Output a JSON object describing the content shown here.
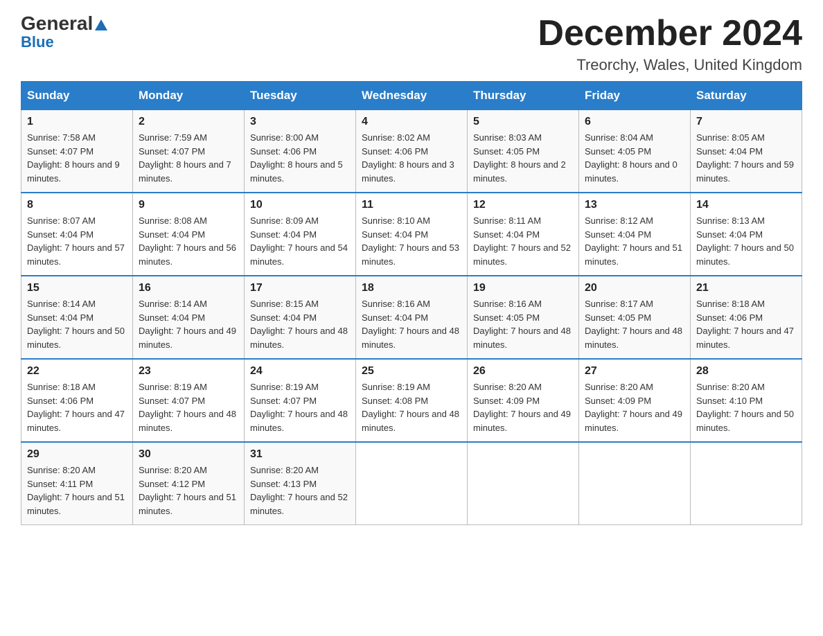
{
  "header": {
    "logo_general": "General",
    "logo_blue": "Blue",
    "month_title": "December 2024",
    "location": "Treorchy, Wales, United Kingdom"
  },
  "weekdays": [
    "Sunday",
    "Monday",
    "Tuesday",
    "Wednesday",
    "Thursday",
    "Friday",
    "Saturday"
  ],
  "weeks": [
    [
      {
        "day": "1",
        "sunrise": "7:58 AM",
        "sunset": "4:07 PM",
        "daylight": "8 hours and 9 minutes."
      },
      {
        "day": "2",
        "sunrise": "7:59 AM",
        "sunset": "4:07 PM",
        "daylight": "8 hours and 7 minutes."
      },
      {
        "day": "3",
        "sunrise": "8:00 AM",
        "sunset": "4:06 PM",
        "daylight": "8 hours and 5 minutes."
      },
      {
        "day": "4",
        "sunrise": "8:02 AM",
        "sunset": "4:06 PM",
        "daylight": "8 hours and 3 minutes."
      },
      {
        "day": "5",
        "sunrise": "8:03 AM",
        "sunset": "4:05 PM",
        "daylight": "8 hours and 2 minutes."
      },
      {
        "day": "6",
        "sunrise": "8:04 AM",
        "sunset": "4:05 PM",
        "daylight": "8 hours and 0 minutes."
      },
      {
        "day": "7",
        "sunrise": "8:05 AM",
        "sunset": "4:04 PM",
        "daylight": "7 hours and 59 minutes."
      }
    ],
    [
      {
        "day": "8",
        "sunrise": "8:07 AM",
        "sunset": "4:04 PM",
        "daylight": "7 hours and 57 minutes."
      },
      {
        "day": "9",
        "sunrise": "8:08 AM",
        "sunset": "4:04 PM",
        "daylight": "7 hours and 56 minutes."
      },
      {
        "day": "10",
        "sunrise": "8:09 AM",
        "sunset": "4:04 PM",
        "daylight": "7 hours and 54 minutes."
      },
      {
        "day": "11",
        "sunrise": "8:10 AM",
        "sunset": "4:04 PM",
        "daylight": "7 hours and 53 minutes."
      },
      {
        "day": "12",
        "sunrise": "8:11 AM",
        "sunset": "4:04 PM",
        "daylight": "7 hours and 52 minutes."
      },
      {
        "day": "13",
        "sunrise": "8:12 AM",
        "sunset": "4:04 PM",
        "daylight": "7 hours and 51 minutes."
      },
      {
        "day": "14",
        "sunrise": "8:13 AM",
        "sunset": "4:04 PM",
        "daylight": "7 hours and 50 minutes."
      }
    ],
    [
      {
        "day": "15",
        "sunrise": "8:14 AM",
        "sunset": "4:04 PM",
        "daylight": "7 hours and 50 minutes."
      },
      {
        "day": "16",
        "sunrise": "8:14 AM",
        "sunset": "4:04 PM",
        "daylight": "7 hours and 49 minutes."
      },
      {
        "day": "17",
        "sunrise": "8:15 AM",
        "sunset": "4:04 PM",
        "daylight": "7 hours and 48 minutes."
      },
      {
        "day": "18",
        "sunrise": "8:16 AM",
        "sunset": "4:04 PM",
        "daylight": "7 hours and 48 minutes."
      },
      {
        "day": "19",
        "sunrise": "8:16 AM",
        "sunset": "4:05 PM",
        "daylight": "7 hours and 48 minutes."
      },
      {
        "day": "20",
        "sunrise": "8:17 AM",
        "sunset": "4:05 PM",
        "daylight": "7 hours and 48 minutes."
      },
      {
        "day": "21",
        "sunrise": "8:18 AM",
        "sunset": "4:06 PM",
        "daylight": "7 hours and 47 minutes."
      }
    ],
    [
      {
        "day": "22",
        "sunrise": "8:18 AM",
        "sunset": "4:06 PM",
        "daylight": "7 hours and 47 minutes."
      },
      {
        "day": "23",
        "sunrise": "8:19 AM",
        "sunset": "4:07 PM",
        "daylight": "7 hours and 48 minutes."
      },
      {
        "day": "24",
        "sunrise": "8:19 AM",
        "sunset": "4:07 PM",
        "daylight": "7 hours and 48 minutes."
      },
      {
        "day": "25",
        "sunrise": "8:19 AM",
        "sunset": "4:08 PM",
        "daylight": "7 hours and 48 minutes."
      },
      {
        "day": "26",
        "sunrise": "8:20 AM",
        "sunset": "4:09 PM",
        "daylight": "7 hours and 49 minutes."
      },
      {
        "day": "27",
        "sunrise": "8:20 AM",
        "sunset": "4:09 PM",
        "daylight": "7 hours and 49 minutes."
      },
      {
        "day": "28",
        "sunrise": "8:20 AM",
        "sunset": "4:10 PM",
        "daylight": "7 hours and 50 minutes."
      }
    ],
    [
      {
        "day": "29",
        "sunrise": "8:20 AM",
        "sunset": "4:11 PM",
        "daylight": "7 hours and 51 minutes."
      },
      {
        "day": "30",
        "sunrise": "8:20 AM",
        "sunset": "4:12 PM",
        "daylight": "7 hours and 51 minutes."
      },
      {
        "day": "31",
        "sunrise": "8:20 AM",
        "sunset": "4:13 PM",
        "daylight": "7 hours and 52 minutes."
      },
      null,
      null,
      null,
      null
    ]
  ]
}
